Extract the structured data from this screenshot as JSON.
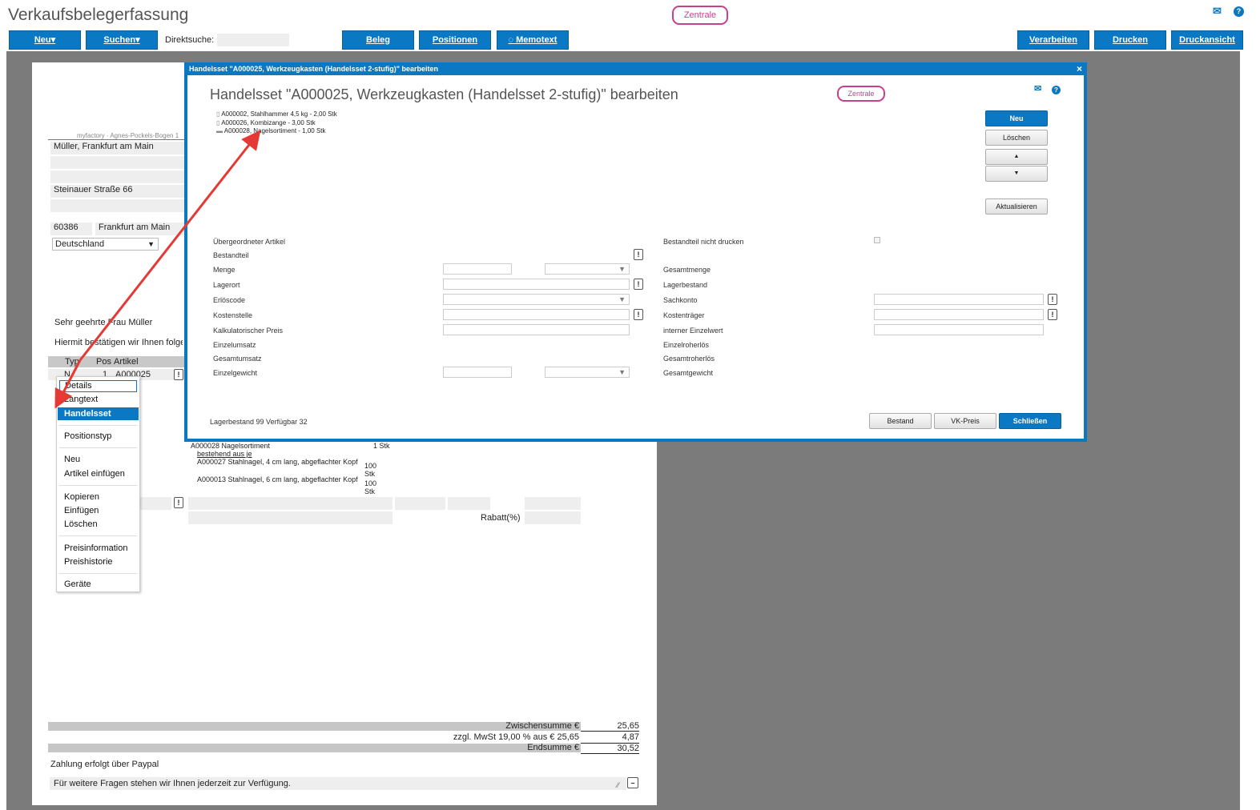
{
  "app": {
    "title": "Verkaufsbelegerfassung",
    "badge": "Zentrale",
    "toolbar": {
      "neu": "Neu",
      "suchen": "Suchen",
      "direktsuche_label": "Direktsuche:",
      "beleg": "Beleg",
      "positionen": "Positionen",
      "memotext": "Memotext",
      "verarbeiten": "Verarbeiten",
      "drucken": "Drucken",
      "druckansicht": "Druckansicht"
    }
  },
  "document": {
    "sender_line": "myfactory · Agnes-Pockels-Bogen 1",
    "address_name": "Müller, Frankfurt am Main",
    "street": "Steinauer Straße 66",
    "zip": "60386",
    "city": "Frankfurt am Main",
    "country": "Deutschland",
    "greeting": "Sehr geehrte Frau Müller",
    "intro": "Hiermit bestätigen wir Ihnen folgende",
    "table_headers": {
      "typ": "Typ",
      "pos": "Pos",
      "artikel": "Artikel"
    },
    "row": {
      "typ": "N",
      "pos": "1",
      "artikel": "A000025"
    },
    "components": [
      {
        "text": "A000028 Nagelsortiment",
        "qty": "1 Stk"
      },
      {
        "text": "bestehend aus je",
        "qty": ""
      },
      {
        "text": "A000027 Stahlnagel, 4 cm lang, abgeflachter Kopf",
        "qty": "100 Stk"
      },
      {
        "text": "A000013 Stahlnagel, 6 cm lang, abgeflachter Kopf",
        "qty": "100 Stk"
      }
    ],
    "rabatt_label": "Rabatt(%)",
    "zwischensumme_label": "Zwischensumme €",
    "zwischensumme": "25,65",
    "mwst_label": "zzgl. MwSt 19,00 % aus € 25,65",
    "mwst": "4,87",
    "endsumme_label": "Endsumme €",
    "endsumme": "30,52",
    "payment": "Zahlung erfolgt über Paypal",
    "closing": "Für weitere Fragen stehen wir Ihnen jederzeit zur Verfügung."
  },
  "context_menu": {
    "items": [
      "Details",
      "Langtext",
      "Handelsset",
      "Positionstyp",
      "Neu",
      "Artikel einfügen",
      "Kopieren",
      "Einfügen",
      "Löschen",
      "Preisinformation",
      "Preishistorie",
      "Geräte"
    ],
    "selected": "Handelsset"
  },
  "dialog": {
    "titlebar": "Handelsset \"A000025, Werkzeugkasten (Handelsset 2-stufig)\" bearbeiten",
    "heading": "Handelsset \"A000025, Werkzeugkasten (Handelsset 2-stufig)\" bearbeiten",
    "badge": "Zentrale",
    "close": "×",
    "tree": [
      "A000002, Stahlhammer 4,5 kg - 2,00 Stk",
      "A000026, Kombizange - 3,00 Stk",
      "A000028, Nagelsortiment - 1,00 Stk"
    ],
    "buttons": {
      "neu": "Neu",
      "loeschen": "Löschen",
      "up": "▲",
      "down": "▼",
      "aktualisieren": "Aktualisieren"
    },
    "labels_left": [
      "Übergeordneter Artikel",
      "Bestandteil",
      "Menge",
      "Lagerort",
      "Erlöscode",
      "Kostenstelle",
      "Kalkulatorischer Preis",
      "Einzelumsatz",
      "Gesamtumsatz",
      "Einzelgewicht"
    ],
    "labels_right": [
      "Bestandteil nicht drucken",
      "Gesamtmenge",
      "Lagerbestand",
      "Sachkonto",
      "Kostenträger",
      "interner Einzelwert",
      "Einzelroherlös",
      "Gesamtroherlös",
      "Gesamtgewicht"
    ],
    "status": "Lagerbestand 99 Verfügbar 32",
    "footer_buttons": {
      "bestand": "Bestand",
      "vkpreis": "VK-Preis",
      "schliessen": "Schließen"
    }
  },
  "colors": {
    "accent": "#0b78c3",
    "badge": "#c8408c",
    "arrow": "#e53935",
    "backdrop": "#7b7b7b"
  }
}
